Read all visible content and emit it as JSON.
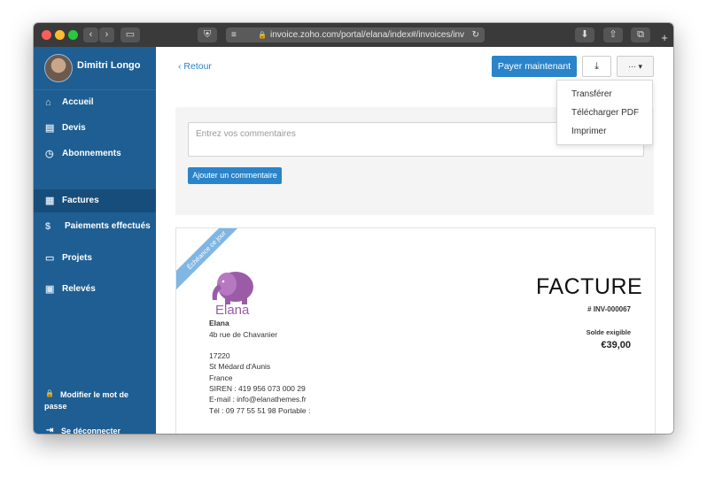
{
  "browser": {
    "url": "invoice.zoho.com/portal/elana/index#/invoices/inv",
    "lock": "🔒",
    "reload": "↻",
    "back": "‹",
    "forward": "›",
    "sidebar_toggle": "▭",
    "shield": "⛨",
    "reader": "≡",
    "download": "⬇",
    "share": "⇧",
    "tabs": "⧉",
    "new_tab": "+"
  },
  "sidebar": {
    "user_name": "Dimitri Longo",
    "items": [
      {
        "label": "Accueil",
        "icon": "⌂"
      },
      {
        "label": "Devis",
        "icon": "▤"
      },
      {
        "label": "Abonnements",
        "icon": "◷"
      },
      {
        "label": "Factures",
        "icon": "▦"
      },
      {
        "label": "Paiements effectués",
        "icon": "$"
      },
      {
        "label": "Projets",
        "icon": "▭"
      },
      {
        "label": "Relevés",
        "icon": "▣"
      }
    ],
    "change_password": "Modifier le mot de passe",
    "change_password_icon": "🔒",
    "logout": "Se déconnecter",
    "logout_icon": "⇥"
  },
  "toolbar": {
    "back_label": "‹ Retour",
    "pay_label": "Payer maintenant",
    "download_icon": "⤓",
    "more_label": "··· ▾"
  },
  "dropdown": {
    "items": [
      "Transférer",
      "Télécharger PDF",
      "Imprimer"
    ]
  },
  "comments": {
    "placeholder": "Entrez vos commentaires",
    "add_label": "Ajouter un commentaire"
  },
  "invoice": {
    "ribbon": "Échéance ce jour",
    "brand": "Elana",
    "company": "Elana",
    "address_lines": [
      "4b rue de Chavanier",
      "",
      "17220",
      "St Médard d'Aunis",
      "France",
      "SIREN : 419 956 073 000 29",
      "E-mail : info@elanathemes.fr",
      "Tél : 09 77 55 51 98 Portable :"
    ],
    "title": "FACTURE",
    "number": "# INV-000067",
    "balance_label": "Solde exigible",
    "balance_value": "€39,00"
  },
  "colors": {
    "sidebar": "#1e5e92",
    "accent": "#2a84c9",
    "brand": "#9b5ba7"
  }
}
